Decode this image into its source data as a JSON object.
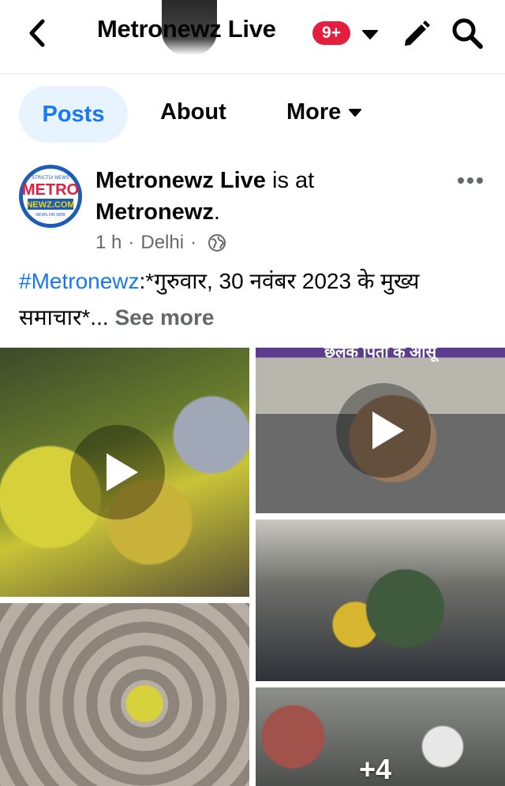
{
  "header": {
    "title": "Metronewz Live",
    "notification_badge": "9+",
    "back_icon": "back-chevron-icon",
    "edit_icon": "pencil-icon",
    "search_icon": "search-icon"
  },
  "tabs": [
    {
      "label": "Posts",
      "active": true
    },
    {
      "label": "About",
      "active": false
    },
    {
      "label": "More",
      "active": false
    }
  ],
  "post": {
    "author": "Metronewz Live",
    "is_at": "is at",
    "location": "Metronewz",
    "time": "1 h",
    "place": "Delhi",
    "privacy_icon": "globe-icon",
    "avatar_text": {
      "top": "STRICTLY NEWS",
      "main": "METRO",
      "sub": "NEWZ.COM",
      "bottom": "NEWS ON WEB"
    },
    "hashtag": "#Metronewz",
    "text": ":*गुरुवार, 30 नवंबर 2023 के मुख्य समाचार*...",
    "see_more": "See more",
    "media_banner": "छलक पिता के आंसू",
    "more_media_count": "+4"
  },
  "colors": {
    "accent": "#1877f2",
    "badge": "#e41e3f",
    "active_tab_bg": "#e7f3ff",
    "secondary_text": "#65676b"
  }
}
